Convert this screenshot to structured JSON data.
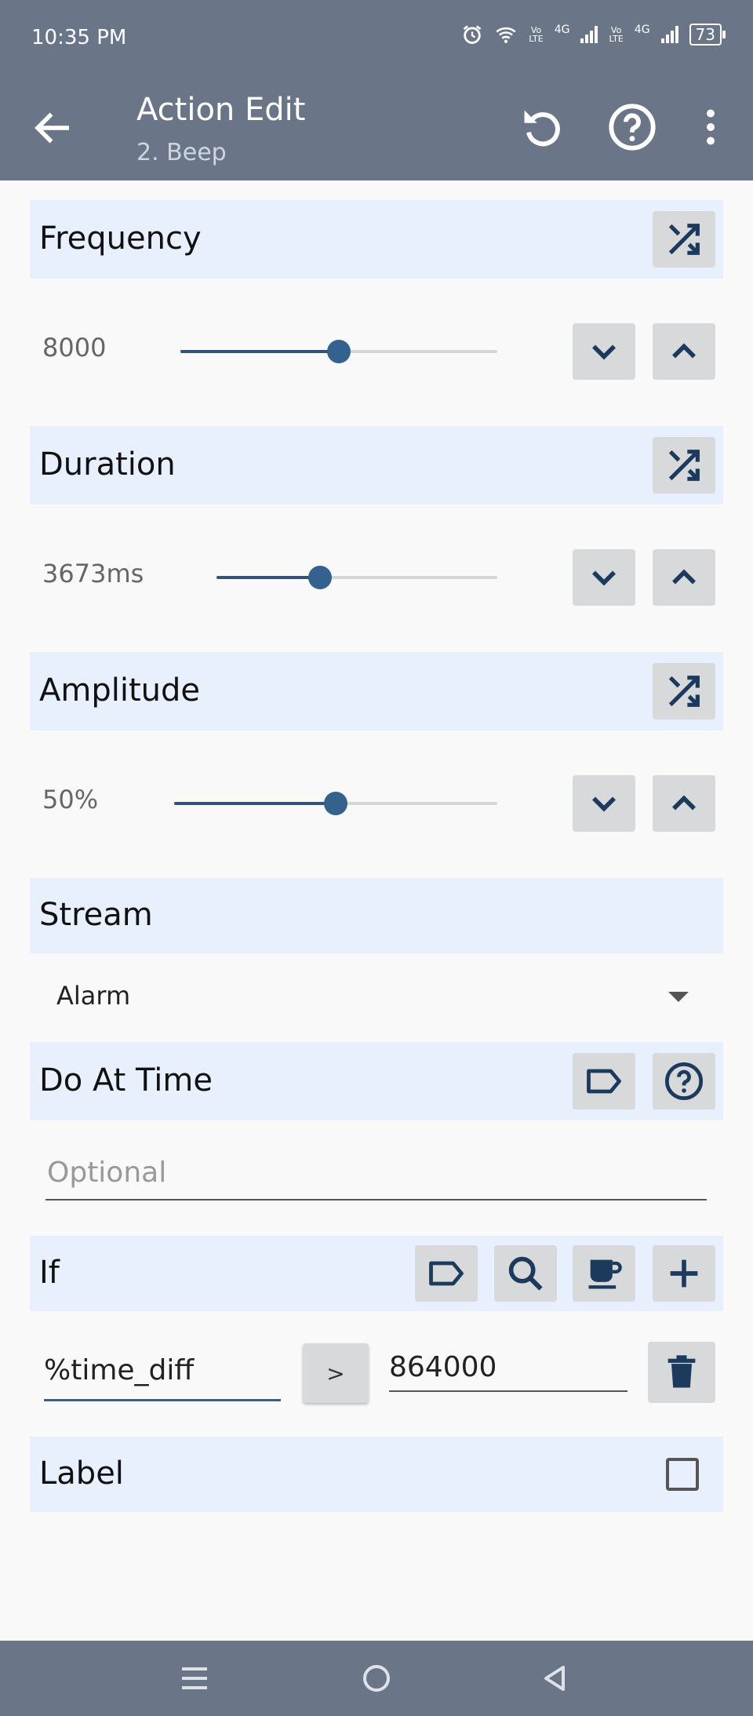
{
  "status_bar": {
    "time": "10:35 PM",
    "volte1_top": "Vo",
    "volte1_bottom": "LTE",
    "net1": "4G",
    "volte2_top": "Vo",
    "volte2_bottom": "LTE",
    "net2": "4G",
    "battery": "73"
  },
  "app_bar": {
    "title": "Action Edit",
    "subtitle": "2. Beep",
    "back_icon": "arrow-back-icon",
    "reset_icon": "undo-icon",
    "help_icon": "help-circle-icon",
    "menu_icon": "more-vert-icon"
  },
  "frequency": {
    "label": "Frequency",
    "value": "8000",
    "slider_level": 0.5
  },
  "duration": {
    "label": "Duration",
    "value": "3673ms",
    "slider_level": 0.37
  },
  "amplitude": {
    "label": "Amplitude",
    "value": "50%",
    "slider_level": 0.5
  },
  "stream": {
    "label": "Stream",
    "selected": "Alarm"
  },
  "do_at_time": {
    "label": "Do At Time",
    "placeholder": "Optional"
  },
  "if_condition": {
    "label": "If",
    "left_operand": "%time_diff",
    "operator": ">",
    "right_operand": "864000"
  },
  "label_section": {
    "label": "Label",
    "checked": false
  },
  "colors": {
    "bar": "#6a7688",
    "section_bg": "#e8effd",
    "accent": "#35618f",
    "icon": "#1b3a5c"
  }
}
